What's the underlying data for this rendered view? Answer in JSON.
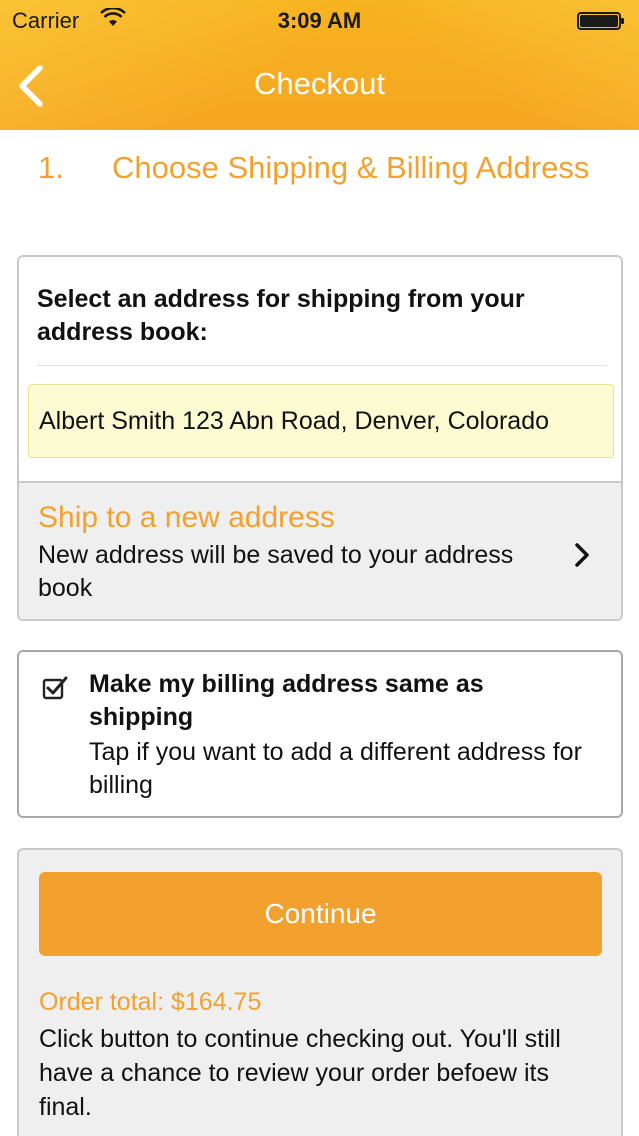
{
  "status_bar": {
    "carrier": "Carrier",
    "time": "3:09 AM"
  },
  "nav": {
    "title": "Checkout",
    "back_icon": "chevron-left-icon"
  },
  "step": {
    "number": "1.",
    "title": "Choose Shipping & Billing Address"
  },
  "shipping": {
    "select_label": "Select an address for shipping from your address book:",
    "selected_address": "Albert Smith 123 Abn Road, Denver, Colorado",
    "new_address_title": "Ship to a new address",
    "new_address_subtitle": "New address will be saved to your address book"
  },
  "billing": {
    "checked": true,
    "title": "Make my billing address same as shipping",
    "subtitle": "Tap if you want to add a different address for billing"
  },
  "order": {
    "continue_label": "Continue",
    "total": "Order total: $164.75",
    "note": "Click button to continue checking out. You'll still have a chance to review your order befoew its final."
  },
  "colors": {
    "accent": "#f2a12e",
    "header": "#f6a623",
    "selected_bg": "#fdfbd2"
  }
}
